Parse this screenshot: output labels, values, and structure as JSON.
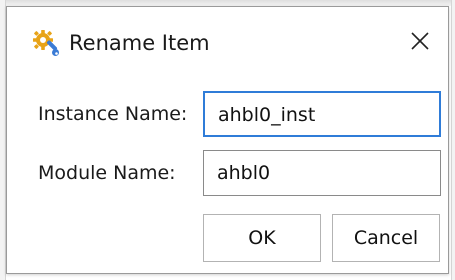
{
  "dialog": {
    "title": "Rename Item",
    "icon": "wrench-gear-icon",
    "close_icon": "close-icon"
  },
  "form": {
    "instance_label": "Instance Name:",
    "instance_value": "ahbl0_inst",
    "module_label": "Module Name:",
    "module_value": "ahbl0"
  },
  "buttons": {
    "ok_label": "OK",
    "cancel_label": "Cancel"
  },
  "colors": {
    "focus_border": "#2f7cd8",
    "icon_primary": "#e8a317",
    "icon_secondary": "#3a7bd5"
  }
}
